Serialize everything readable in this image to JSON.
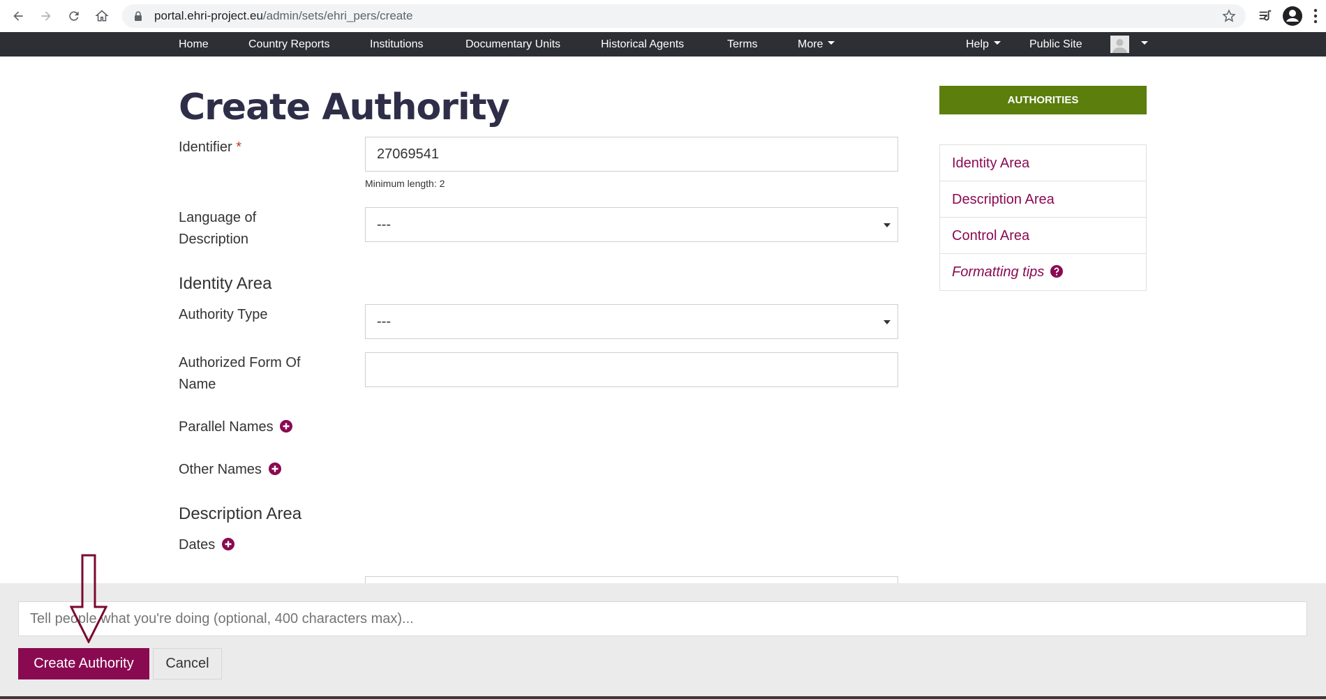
{
  "browser": {
    "url_host": "portal.ehri-project.eu",
    "url_path": "/admin/sets/ehri_pers/create"
  },
  "topnav": {
    "items": [
      "Home",
      "Country Reports",
      "Institutions",
      "Documentary Units",
      "Historical Agents",
      "Terms",
      "More"
    ],
    "help": "Help",
    "public_site": "Public Site"
  },
  "form": {
    "title": "Create Authority",
    "identifier_label": "Identifier",
    "required_mark": "*",
    "identifier_value": "27069541",
    "identifier_help": "Minimum length: 2",
    "language_label_line1": "Language of",
    "language_label_line2": "Description",
    "language_value": "---",
    "identity_area_heading": "Identity Area",
    "authority_type_label": "Authority Type",
    "authority_type_value": "---",
    "authorized_form_line1": "Authorized Form Of",
    "authorized_form_line2": "Name",
    "authorized_form_value": "",
    "parallel_names_label": "Parallel Names",
    "other_names_label": "Other Names",
    "description_area_heading": "Description Area",
    "dates_label": "Dates"
  },
  "sidebar": {
    "header": "AUTHORITIES",
    "items": [
      "Identity Area",
      "Description Area",
      "Control Area",
      "Formatting tips"
    ]
  },
  "footer": {
    "log_placeholder": "Tell people what you're doing (optional, 400 characters max)...",
    "create_button": "Create Authority",
    "cancel_button": "Cancel"
  },
  "colors": {
    "brand": "#8a0a52",
    "nav_bg": "#2d2f35",
    "sidebar_header": "#5b7e0c"
  }
}
